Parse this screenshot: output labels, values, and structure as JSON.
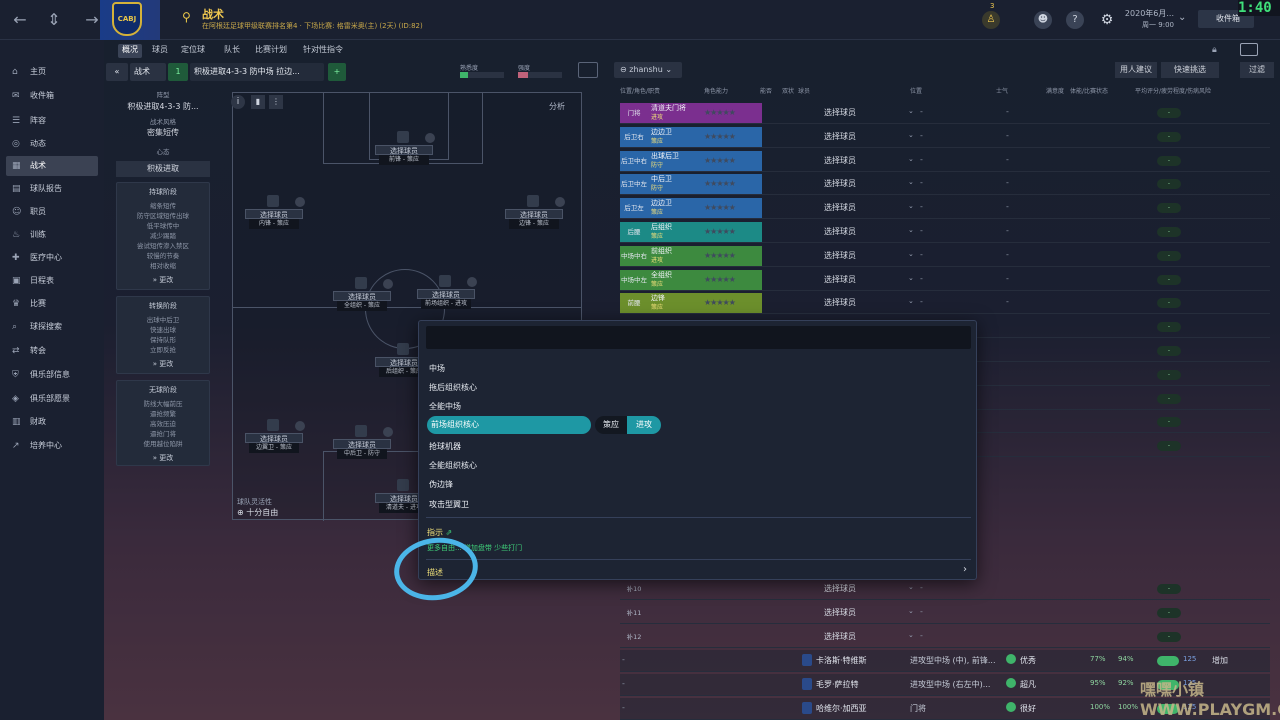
{
  "topbar": {
    "title": "战术",
    "subtitle": "在阿根廷足球甲级联赛排名第4 · 下场比赛: 格雷米奥(主) (2天) (ID:82)",
    "crest_text": "CABJ",
    "date": "2020年6月...",
    "day": "周一 9:00",
    "inbox": "收件箱",
    "clock": "1:40",
    "badge": "3"
  },
  "sidebar": {
    "items": [
      {
        "label": "主页",
        "icon": "home-icon",
        "glyph": "⌂"
      },
      {
        "label": "收件箱",
        "icon": "inbox-icon",
        "glyph": "✉"
      },
      {
        "label": "阵容",
        "icon": "squad-icon",
        "glyph": "☰"
      },
      {
        "label": "动态",
        "icon": "dynamics-icon",
        "glyph": "◎"
      },
      {
        "label": "战术",
        "icon": "tactics-icon",
        "glyph": "▦"
      },
      {
        "label": "球队报告",
        "icon": "report-icon",
        "glyph": "▤"
      },
      {
        "label": "职员",
        "icon": "staff-icon",
        "glyph": "☺"
      },
      {
        "label": "训练",
        "icon": "training-icon",
        "glyph": "♨"
      },
      {
        "label": "医疗中心",
        "icon": "medical-icon",
        "glyph": "✚"
      },
      {
        "label": "日程表",
        "icon": "calendar-icon",
        "glyph": "▣"
      },
      {
        "label": "比赛",
        "icon": "trophy-icon",
        "glyph": "♛"
      },
      {
        "label": "球探搜索",
        "icon": "scouting-icon",
        "glyph": "⌕"
      },
      {
        "label": "转会",
        "icon": "transfers-icon",
        "glyph": "⇄"
      },
      {
        "label": "俱乐部信息",
        "icon": "club-info-icon",
        "glyph": "⛨"
      },
      {
        "label": "俱乐部愿景",
        "icon": "vision-icon",
        "glyph": "◈"
      },
      {
        "label": "财政",
        "icon": "finance-icon",
        "glyph": "▥"
      },
      {
        "label": "培养中心",
        "icon": "development-icon",
        "glyph": "↗"
      }
    ]
  },
  "tabs": [
    "概况",
    "球员",
    "定位球",
    "队长",
    "比赛计划",
    "针对性指令"
  ],
  "tactic": {
    "back": "«",
    "label": "战术",
    "number": "1",
    "name": "积极进取4-3-3 防中场 拉边...",
    "familiarity_label": "熟悉度",
    "fluidity_label": "强度"
  },
  "left_panel": {
    "formation_label": "阵型",
    "formation": "积极进取4-3-3 防...",
    "style_label": "战术风格",
    "style": "密集短传",
    "mentality_label": "心态",
    "mentality": "积极进取",
    "phase1": {
      "title": "持球阶段",
      "lines": [
        "缩条短传",
        "防守区域短传出球",
        "低平球传中",
        "减少踢踏",
        "尝试短传渗入禁区",
        "较慢的节奏",
        "相对收缩"
      ],
      "change": "更改"
    },
    "phase2": {
      "title": "转换阶段",
      "lines": [
        "出球中后卫",
        "快速出球",
        "保持队形",
        "立即反抢"
      ],
      "change": "更改"
    },
    "phase3": {
      "title": "无球阶段",
      "lines": [
        "防线大幅前压",
        "逼抢频繁",
        "高效压迫",
        "逼抢门将",
        "使用越位陷阱"
      ],
      "change": "更改"
    },
    "fluidity_label": "球队灵活性",
    "fluidity": "十分自由"
  },
  "pitch": {
    "select_label": "选择球员",
    "analysis": "分析",
    "slots": [
      {
        "role": "前锋 - 策应"
      },
      {
        "role": "内锋 - 策应"
      },
      {
        "role": "边锋 - 策应"
      },
      {
        "role": "全组织 - 策应"
      },
      {
        "role": "前场组织 - 进攻"
      },
      {
        "role": "后组织 - 策应"
      },
      {
        "role": "边翼卫 - 策应"
      },
      {
        "role": "中后卫 - 防守"
      },
      {
        "role": "清道夫 - 进攻"
      }
    ]
  },
  "right_panel": {
    "player_filter": "zhanshu",
    "buttons": [
      "用人建议",
      "快速挑选",
      "过滤"
    ],
    "headers": [
      "位置/角色/职责",
      "角色能力",
      "能否",
      "双状",
      "球员",
      "位置",
      "士气",
      "满意度",
      "体能/比赛状态",
      "平均评分/疲劳程度/伤病风险"
    ],
    "rows": [
      {
        "pos": "门将",
        "role": "清道夫门将",
        "duty": "进攻",
        "color": "#7b2f8f"
      },
      {
        "pos": "后卫右",
        "role": "边边卫",
        "duty": "策应",
        "color": "#2a66a8"
      },
      {
        "pos": "后卫中右",
        "role": "出球后卫",
        "duty": "防守",
        "color": "#2a66a8"
      },
      {
        "pos": "后卫中左",
        "role": "中后卫",
        "duty": "防守",
        "color": "#2a66a8"
      },
      {
        "pos": "后卫左",
        "role": "边边卫",
        "duty": "策应",
        "color": "#2a66a8"
      },
      {
        "pos": "后腰",
        "role": "后组织",
        "duty": "策应",
        "color": "#1c8a86"
      },
      {
        "pos": "中场中右",
        "role": "前组织",
        "duty": "进攻",
        "color": "#3d8a3f"
      },
      {
        "pos": "中场中左",
        "role": "全组织",
        "duty": "策应",
        "color": "#3d8a3f"
      },
      {
        "pos": "前腰",
        "role": "边锋",
        "duty": "策应",
        "color": "#6c8f2c"
      }
    ],
    "select_label": "选择球员",
    "subs": [
      "补10",
      "补11",
      "补12"
    ],
    "players": [
      {
        "name": "卡洛斯·特维斯",
        "position": "进攻型中场 (中), 前锋...",
        "morale": "优秀",
        "pct1": "77%",
        "pct2": "94%",
        "value": "125",
        "action": "增加"
      },
      {
        "name": "毛罗·萨拉特",
        "position": "进攻型中场 (右左中)...",
        "morale": "超凡",
        "pct1": "95%",
        "pct2": "92%",
        "value": "125",
        "action": ""
      },
      {
        "name": "哈维尔·加西亚",
        "position": "门将",
        "morale": "很好",
        "pct1": "100%",
        "pct2": "100%",
        "value": "125",
        "action": ""
      }
    ]
  },
  "popup": {
    "category": "中场",
    "roles": [
      "拖后组织核心",
      "全能中场",
      "前场组织核心",
      "抢球机器",
      "全能组织核心",
      "伪边锋",
      "攻击型翼卫"
    ],
    "duty_support": "策应",
    "duty_attack": "进攻",
    "hint": "指示",
    "more": "更多自由...",
    "more_links": [
      "增加盘带",
      "少些打门"
    ],
    "describe": "描述"
  },
  "watermark": "嘿嘿小镇 WWW.PLAYGM.CC"
}
